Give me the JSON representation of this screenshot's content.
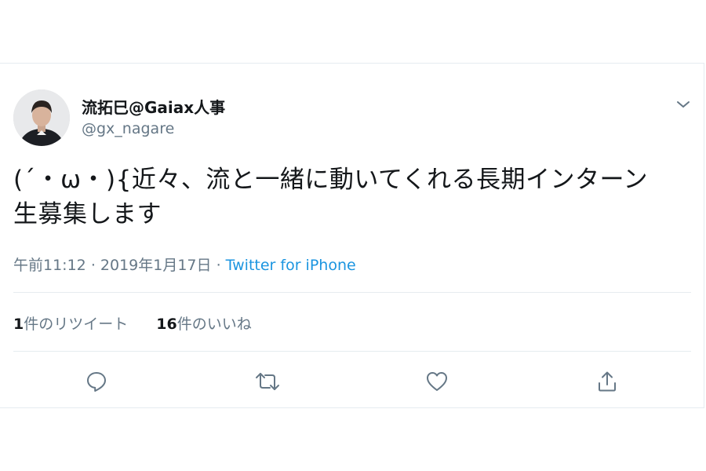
{
  "tweet": {
    "display_name": "流拓巳@Gaiax人事",
    "handle": "@gx_nagare",
    "text_line1": "(´・ω・){近々、流と一緒に動いてくれる長期インターン",
    "text_line2": "生募集します",
    "time": "午前11:12",
    "separator": "·",
    "date": "2019年1月17日",
    "source": "Twitter for iPhone",
    "retweet_count": "1",
    "retweet_label": "件のリツイート",
    "like_count": "16",
    "like_label": "件のいいね"
  },
  "icons": {
    "more": "chevron-down-icon",
    "reply": "reply-icon",
    "retweet": "retweet-icon",
    "like": "heart-icon",
    "share": "share-icon"
  },
  "colors": {
    "text": "#14171a",
    "secondary": "#657786",
    "link": "#1b95e0",
    "border": "#e6ecf0"
  }
}
